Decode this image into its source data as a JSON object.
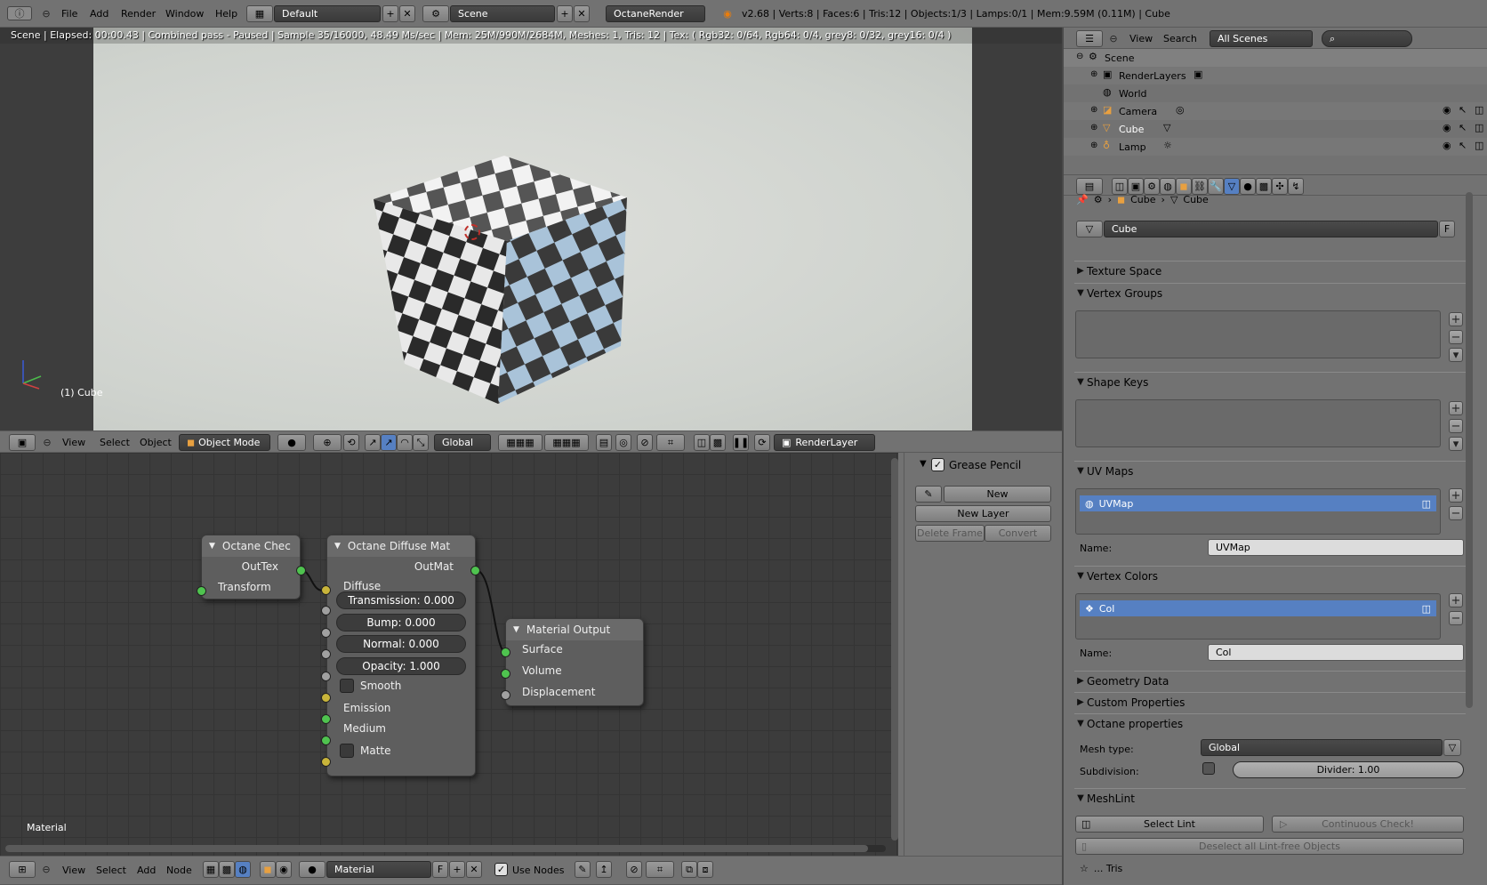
{
  "topbar": {
    "menus": [
      "File",
      "Add",
      "Render",
      "Window",
      "Help"
    ],
    "screen_layout": "Default",
    "scene": "Scene",
    "engine": "OctaneRender",
    "stats": "v2.68 | Verts:8 | Faces:6 | Tris:12 | Objects:1/3 | Lamps:0/1 | Mem:9.59M (0.11M) | Cube"
  },
  "viewport": {
    "status": "Scene | Elapsed: 00:00.43 | Combined pass - Paused | Sample 35/16000, 48.49 Ms/sec | Mem: 25M/990M/2684M, Meshes: 1, Tris: 12 | Tex: ( Rgb32: 0/64, Rgb64: 0/4, grey8: 0/32, grey16: 0/4 )",
    "object_label": "(1) Cube",
    "header": {
      "menus": [
        "View",
        "Select",
        "Object"
      ],
      "mode": "Object Mode",
      "orientation": "Global",
      "render_layer": "RenderLayer"
    }
  },
  "outliner": {
    "menus": [
      "View",
      "Search"
    ],
    "display": "All Scenes",
    "items": [
      {
        "label": "Scene"
      },
      {
        "label": "RenderLayers"
      },
      {
        "label": "World"
      },
      {
        "label": "Camera"
      },
      {
        "label": "Cube"
      },
      {
        "label": "Lamp"
      }
    ]
  },
  "properties": {
    "breadcrumb": [
      "Cube",
      "Cube"
    ],
    "datablock": "Cube",
    "datablock_fake": "F",
    "panels": {
      "texture_space": "Texture Space",
      "vertex_groups": "Vertex Groups",
      "shape_keys": "Shape Keys",
      "uv_maps": "UV Maps",
      "vertex_colors": "Vertex Colors",
      "geometry_data": "Geometry Data",
      "custom_properties": "Custom Properties",
      "octane_properties": "Octane properties",
      "meshlint": "MeshLint"
    },
    "uv_map_item": "UVMap",
    "uv_name_label": "Name:",
    "uv_name_value": "UVMap",
    "vc_item": "Col",
    "vc_name_label": "Name:",
    "vc_name_value": "Col",
    "mesh_type_label": "Mesh type:",
    "mesh_type_value": "Global",
    "subdivision_label": "Subdivision:",
    "divider_value": "Divider: 1.00",
    "select_lint": "Select Lint",
    "continuous_check": "Continuous Check!",
    "deselect_lint": "Deselect all Lint-free Objects",
    "tris_label": "... Tris"
  },
  "node_editor": {
    "label": "Material",
    "header": {
      "menus": [
        "View",
        "Select",
        "Add",
        "Node"
      ],
      "material": "Material",
      "fake": "F",
      "use_nodes": "Use Nodes"
    },
    "nodes": {
      "checks": {
        "title": "Octane Chec",
        "out": "OutTex",
        "in": "Transform"
      },
      "diffuse": {
        "title": "Octane Diffuse Mat",
        "out": "OutMat",
        "diffuse": "Diffuse",
        "transmission": "Transmission: 0.000",
        "bump": "Bump: 0.000",
        "normal": "Normal: 0.000",
        "opacity": "Opacity: 1.000",
        "smooth": "Smooth",
        "emission": "Emission",
        "medium": "Medium",
        "matte": "Matte"
      },
      "output": {
        "title": "Material Output",
        "surface": "Surface",
        "volume": "Volume",
        "displacement": "Displacement"
      }
    }
  },
  "grease_pencil": {
    "title": "Grease Pencil",
    "new": "New",
    "new_layer": "New Layer",
    "delete_frame": "Delete Frame",
    "convert": "Convert"
  },
  "colors": {
    "selection": "#5680c2",
    "socket_green": "#4fc34f",
    "socket_yellow": "#c8b43a",
    "socket_grey": "#a0a0a0"
  }
}
